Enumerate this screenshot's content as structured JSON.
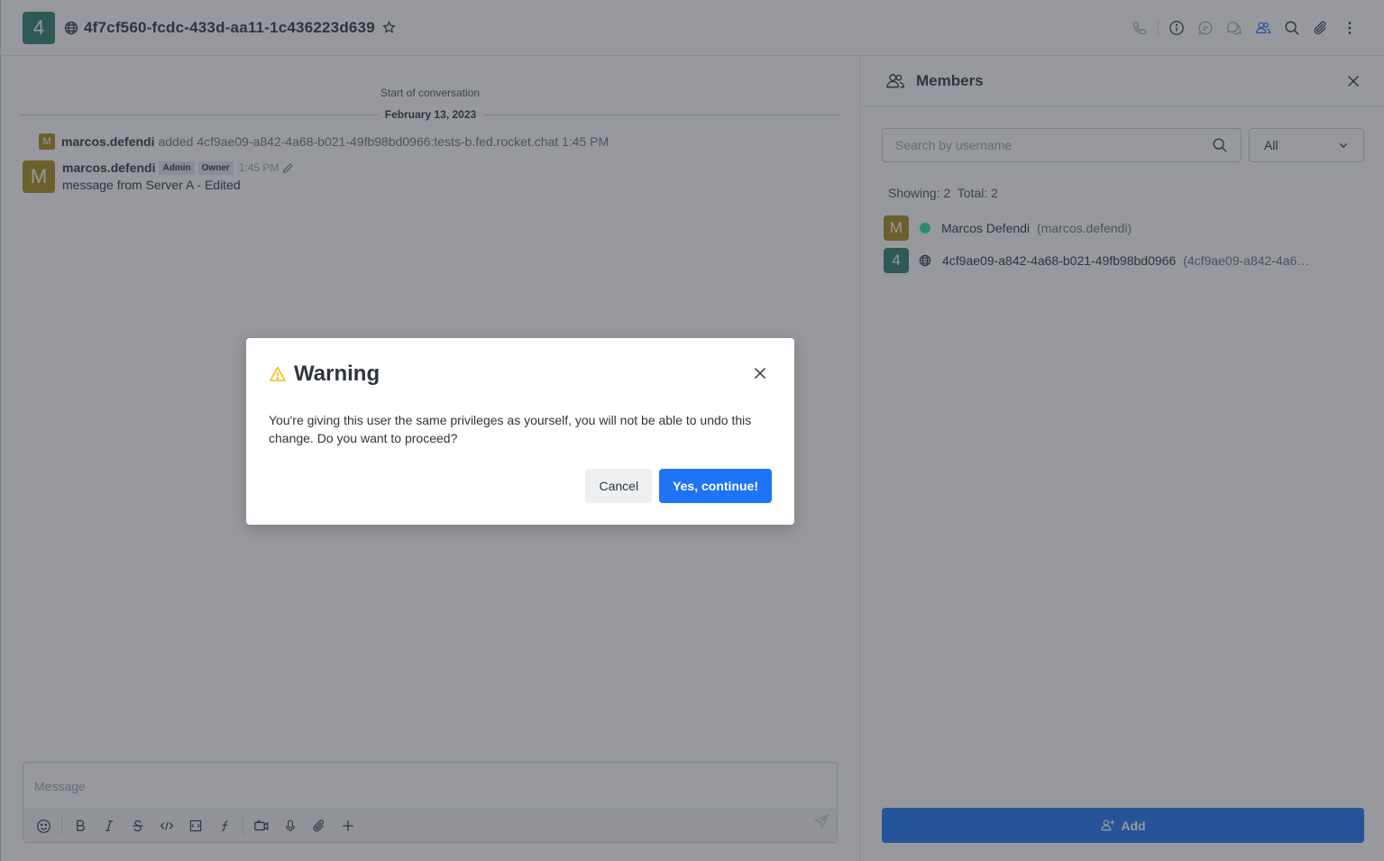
{
  "header": {
    "room_avatar_letter": "4",
    "room_title": "4f7cf560-fcdc-433d-aa11-1c436223d639",
    "toolbar_icons": [
      "phone-icon",
      "info-icon",
      "discussion-icon",
      "threads-icon",
      "members-icon",
      "search-icon",
      "attachment-icon",
      "kebab-icon"
    ]
  },
  "chat": {
    "start_label": "Start of conversation",
    "date_divider": "February 13, 2023",
    "system_message": {
      "avatar_letter": "M",
      "username": "marcos.defendi",
      "text": "added 4cf9ae09-a842-4a68-b021-49fb98bd0966:tests-b.fed.rocket.chat 1:45 PM"
    },
    "message": {
      "avatar_letter": "M",
      "username": "marcos.defendi",
      "roles": [
        "Admin",
        "Owner"
      ],
      "time": "1:45 PM",
      "text": "message from Server A - Edited"
    }
  },
  "composer": {
    "placeholder": "Message",
    "tools": [
      "emoji-icon",
      "bold-icon",
      "italic-icon",
      "strike-icon",
      "code-icon",
      "code-block-icon",
      "formula-icon",
      "video-icon",
      "mic-icon",
      "attach-icon",
      "plus-icon"
    ]
  },
  "members_panel": {
    "title": "Members",
    "search_placeholder": "Search by username",
    "filter_value": "All",
    "counts": "Showing: 2  Total: 2",
    "members": [
      {
        "avatar_letter": "M",
        "name": "Marcos Defendi",
        "handle": "(marcos.defendi)",
        "status": "online"
      },
      {
        "avatar_letter": "4",
        "name": "4cf9ae09-a842-4a68-b021-49fb98bd0966",
        "handle": "(4cf9ae09-a842-4a6…",
        "status": "federated"
      }
    ],
    "add_label": "Add"
  },
  "modal": {
    "title": "Warning",
    "text": "You're giving this user the same privileges as yourself, you will not be able to undo this change. Do you want to proceed?",
    "cancel_label": "Cancel",
    "confirm_label": "Yes, continue!"
  },
  "colors": {
    "accent": "#1d74f5",
    "room_avatar": "#2f7f67",
    "user_avatar": "#a68a1a",
    "online": "#2de0a5",
    "warning": "#f3be08",
    "overlay": "rgba(47,52,61,0.5)"
  }
}
